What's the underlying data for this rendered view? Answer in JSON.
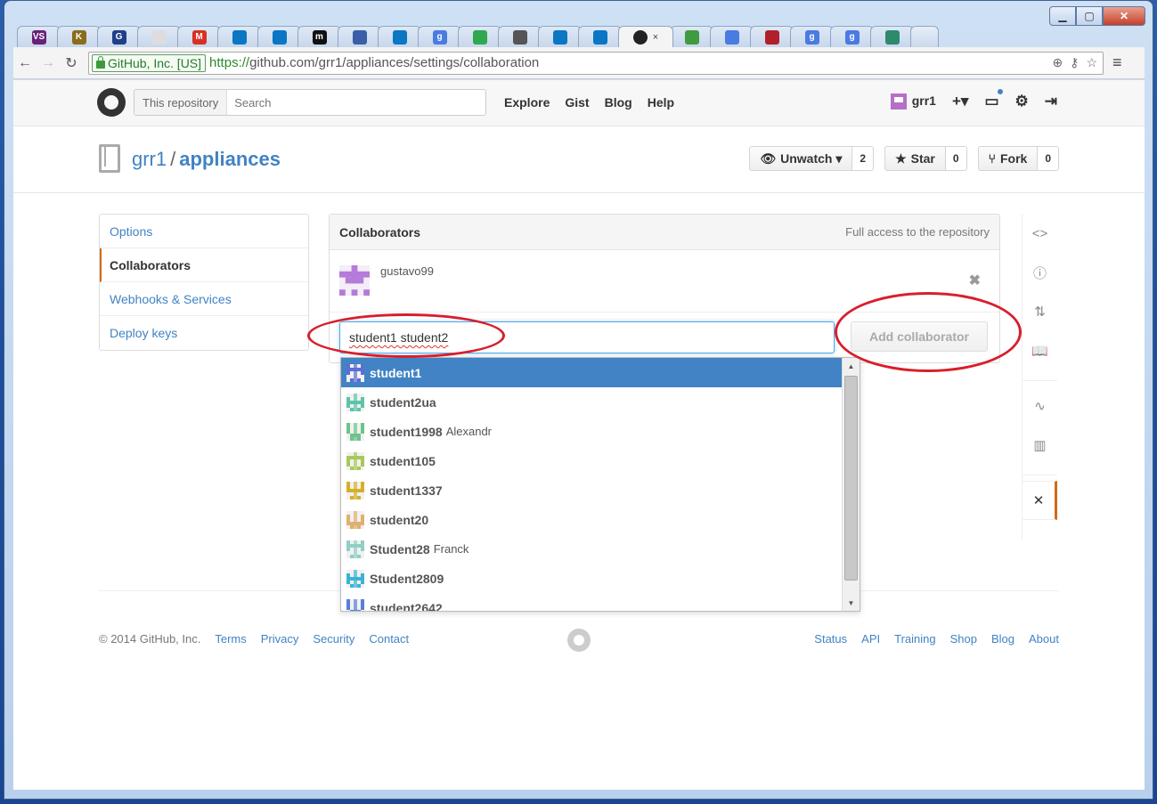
{
  "browser": {
    "tab_close": "×",
    "tabs": [
      {
        "icon": "vs-icon",
        "glyph": "VS",
        "color": "#68217a"
      },
      {
        "icon": "k-icon",
        "glyph": "K",
        "color": "#8a6d1a"
      },
      {
        "icon": "g-icon",
        "glyph": "G",
        "color": "#1e3f8a"
      },
      {
        "icon": "page-icon",
        "glyph": "",
        "color": "#dddddd"
      },
      {
        "icon": "gmail-icon",
        "glyph": "M",
        "color": "#d93025"
      },
      {
        "icon": "dell-icon",
        "glyph": "",
        "color": "#0b76c3"
      },
      {
        "icon": "dell-icon",
        "glyph": "",
        "color": "#0b76c3"
      },
      {
        "icon": "m-icon",
        "glyph": "m",
        "color": "#111111"
      },
      {
        "icon": "vtk-icon",
        "glyph": "",
        "color": "#3a5ea8"
      },
      {
        "icon": "dell-icon",
        "glyph": "",
        "color": "#0b76c3"
      },
      {
        "icon": "google-icon",
        "glyph": "g",
        "color": "#4a7be0"
      },
      {
        "icon": "colorful-icon",
        "glyph": "",
        "color": "#2fa84f"
      },
      {
        "icon": "gamepad-icon",
        "glyph": "",
        "color": "#555555"
      },
      {
        "icon": "dell-icon",
        "glyph": "",
        "color": "#0b76c3"
      },
      {
        "icon": "dell-icon",
        "glyph": "",
        "color": "#0b76c3"
      }
    ],
    "after_tabs": [
      {
        "icon": "leaf-icon",
        "glyph": "",
        "color": "#3f9b3f"
      },
      {
        "icon": "loading-icon",
        "glyph": "",
        "color": "#4a7be0"
      },
      {
        "icon": "power-icon",
        "glyph": "",
        "color": "#b0202a"
      },
      {
        "icon": "google-icon",
        "glyph": "g",
        "color": "#4a7be0"
      },
      {
        "icon": "google-icon",
        "glyph": "g",
        "color": "#4a7be0"
      },
      {
        "icon": "bird-icon",
        "glyph": "",
        "color": "#2d8a6d"
      }
    ],
    "ev_label": "GitHub, Inc. [US]",
    "url_scheme": "https://",
    "url_rest": "github.com/grr1/appliances/settings/collaboration"
  },
  "header": {
    "search_scope": "This repository",
    "search_placeholder": "Search",
    "nav": [
      "Explore",
      "Gist",
      "Blog",
      "Help"
    ],
    "username": "grr1",
    "plus": "+▾"
  },
  "repo": {
    "owner": "grr1",
    "separator": "/",
    "name": "appliances",
    "unwatch_label": "Unwatch ▾",
    "unwatch_count": "2",
    "star_label": "Star",
    "star_count": "0",
    "fork_label": "Fork",
    "fork_count": "0"
  },
  "settings_menu": [
    {
      "label": "Options",
      "selected": false
    },
    {
      "label": "Collaborators",
      "selected": true
    },
    {
      "label": "Webhooks & Services",
      "selected": false
    },
    {
      "label": "Deploy keys",
      "selected": false
    }
  ],
  "collaborators": {
    "title": "Collaborators",
    "note": "Full access to the repository",
    "existing": "gustavo99",
    "remove": "✖",
    "input_value": "student1 student2",
    "add_button": "Add collaborator"
  },
  "suggestions": [
    {
      "login": "student1",
      "full": "",
      "color": "#5b6fd6",
      "highlighted": true
    },
    {
      "login": "student2ua",
      "full": "",
      "color": "#5cc4a8",
      "highlighted": false
    },
    {
      "login": "student1998",
      "full": "Alexandr",
      "color": "#6cc48a",
      "highlighted": false
    },
    {
      "login": "student105",
      "full": "",
      "color": "#a7c957",
      "highlighted": false
    },
    {
      "login": "student1337",
      "full": "",
      "color": "#d4b02a",
      "highlighted": false
    },
    {
      "login": "student20",
      "full": "",
      "color": "#e0b070",
      "highlighted": false
    },
    {
      "login": "Student28",
      "full": "Franck",
      "color": "#8fd0c4",
      "highlighted": false
    },
    {
      "login": "Student2809",
      "full": "",
      "color": "#3ab4d6",
      "highlighted": false
    },
    {
      "login": "student2642",
      "full": "",
      "color": "#5b7fd6",
      "highlighted": false
    }
  ],
  "footer": {
    "copyright": "© 2014 GitHub, Inc.",
    "left_links": [
      "Terms",
      "Privacy",
      "Security",
      "Contact"
    ],
    "right_links": [
      "Status",
      "API",
      "Training",
      "Shop",
      "Blog",
      "About"
    ]
  }
}
